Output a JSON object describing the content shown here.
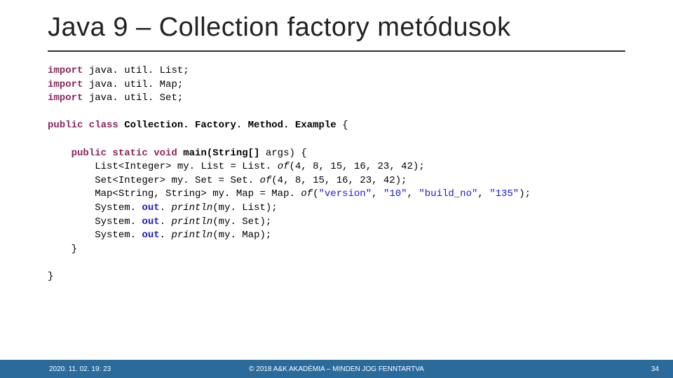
{
  "title": "Java 9 – Collection factory metódusok",
  "code": {
    "l1a": "import",
    "l1b": " java. util. List;",
    "l2a": "import",
    "l2b": " java. util. Map;",
    "l3a": "import",
    "l3b": " java. util. Set;",
    "l5a": "public class ",
    "l5b": "Collection. Factory. Method. Example ",
    "l5c": "{",
    "l7a": "    public static void ",
    "l7b": "main(String[] ",
    "l7c": "args) {",
    "l8a": "        List<Integer> ",
    "l8b": "my. List ",
    "l8c": "= List. ",
    "l8d": "of",
    "l8e": "(4, 8, 15, 16, 23, 42);",
    "l9a": "        Set<Integer> ",
    "l9b": "my. Set ",
    "l9c": "= Set. ",
    "l9d": "of",
    "l9e": "(4, 8, 15, 16, 23, 42);",
    "l10a": "        Map<String, String> ",
    "l10b": "my. Map ",
    "l10c": "= Map. ",
    "l10d": "of",
    "l10e": "(",
    "l10f": "\"version\"",
    "l10g": ", ",
    "l10h": "\"10\"",
    "l10i": ", ",
    "l10j": "\"build_no\"",
    "l10k": ", ",
    "l10l": "\"135\"",
    "l10m": ");",
    "l11a": "        System. ",
    "l11b": "out",
    "l11c": ". ",
    "l11d": "println",
    "l11e": "(my. List);",
    "l12a": "        System. ",
    "l12b": "out",
    "l12c": ". ",
    "l12d": "println",
    "l12e": "(my. Set);",
    "l13a": "        System. ",
    "l13b": "out",
    "l13c": ". ",
    "l13d": "println",
    "l13e": "(my. Map);",
    "l14": "    }",
    "l16": "}"
  },
  "footer": {
    "left": "2020. 11. 02. 19: 23",
    "center": "© 2018 A&K AKADÉMIA – MINDEN JOG FENNTARTVA",
    "right": "34"
  }
}
